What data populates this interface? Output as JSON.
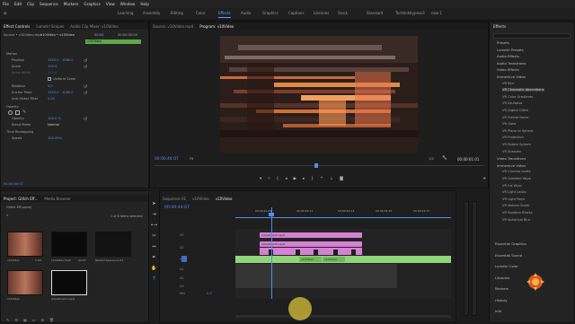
{
  "menu": [
    "File",
    "Edit",
    "Clip",
    "Sequence",
    "Markers",
    "Graphics",
    "View",
    "Window",
    "Help"
  ],
  "workspaces": [
    "Learning",
    "Assembly",
    "Editing",
    "Color",
    "Effects",
    "Audio",
    "Graphics",
    "Captions",
    "Libraries",
    "Stock",
    "Standard",
    "Techlinkbypass3",
    "new 1"
  ],
  "active_workspace": "Effects",
  "effect_controls": {
    "tabs": [
      "Effect Controls",
      "Lumetri Scopes",
      "Audio Clip Mixer: v10Video"
    ],
    "source": "Source • v10Video.mp4",
    "clip": "v10Video • v10Video",
    "time_start": "00:00",
    "time_end": "00:00:30:00",
    "clip_chip": "v10Video",
    "motion": "Motion",
    "position_label": "Position",
    "position_x": "1920.0",
    "position_y": "1080.0",
    "scale_label": "Scale",
    "scale_val": "100.0",
    "scale_w_label": "Scale Width",
    "scale_w_val": "100.0",
    "uniform": "Uniform Scale",
    "rotation_label": "Rotation",
    "rotation_val": "0.0",
    "anchor_label": "Anchor Point",
    "anchor_x": "1920.0",
    "anchor_y": "1080.0",
    "flicker_label": "Anti-flicker Filter",
    "flicker_val": "0.00",
    "opacity_section": "Opacity",
    "opacity_label": "Opacity",
    "opacity_val": "100.0 %",
    "blend_label": "Blend Mode",
    "blend_val": "Normal",
    "time_remap": "Time Remapping",
    "speed_label": "Speed",
    "speed_val": "100.00%",
    "bottom_time": "00:00:44:07"
  },
  "program": {
    "tabs": [
      "Source: v10Video.mp4",
      "Program: v10Video"
    ],
    "time": "00:00:44:07",
    "fit": "Fit",
    "quality": "1/2",
    "duration": "00:00:01:01"
  },
  "project": {
    "tabs": [
      "Project: Glitch Eff...",
      "Media Browser"
    ],
    "file": "Glitch Eff.prproj",
    "count": "1 of 6 items selected",
    "items": [
      {
        "name": "v10Video",
        "meta": "1:03"
      },
      {
        "name": "v10Video.mp4",
        "meta": "44:07"
      },
      {
        "name": "Adjustment Layer",
        "meta": ""
      },
      {
        "name": "Nested Sequence 01",
        "meta": ""
      },
      {
        "name": "v10Video",
        "meta": "1:03"
      },
      {
        "name": "Adjustment Layer",
        "meta": ""
      }
    ]
  },
  "timeline": {
    "tabs": [
      "Sequence 01",
      "v10Video",
      "v10Video"
    ],
    "time": "00:00:44:07",
    "ruler": [
      "00:00:44:09",
      "00:00:44:11",
      "00:00:44:13",
      "00:00:44:15",
      "00:00:44:17"
    ],
    "tracks": [
      "V3",
      "V2",
      "V1",
      "A1",
      "A2",
      "A3",
      "Mix"
    ],
    "mix_val": "0.0",
    "clip_adj1": "Adjustment Layer",
    "clip_adj2": "Adjustment Layer",
    "clip_v1a": "v10Video",
    "clip_v1b": "v10Video"
  },
  "effects": {
    "title": "Effects",
    "tree": [
      {
        "t": "Presets",
        "h": 1
      },
      {
        "t": "Lumetri Presets",
        "h": 1
      },
      {
        "t": "Audio Effects",
        "h": 1
      },
      {
        "t": "Audio Transitions",
        "h": 1
      },
      {
        "t": "Video Effects",
        "h": 1
      },
      {
        "t": "Immersive Video",
        "h": 1
      },
      {
        "t": "VR Blur",
        "h": 0
      },
      {
        "t": "VR Chromatic Aberrations",
        "h": 0
      },
      {
        "t": "VR Color Gradients",
        "h": 0
      },
      {
        "t": "VR De-Noise",
        "h": 0
      },
      {
        "t": "VR Digital Glitch",
        "h": 0
      },
      {
        "t": "VR Fractal Noise",
        "h": 0
      },
      {
        "t": "VR Glow",
        "h": 0
      },
      {
        "t": "VR Plane to Sphere",
        "h": 0
      },
      {
        "t": "VR Projection",
        "h": 0
      },
      {
        "t": "VR Rotate Sphere",
        "h": 0
      },
      {
        "t": "VR Sharpen",
        "h": 0
      },
      {
        "t": "Video Transitions",
        "h": 1
      },
      {
        "t": "Immersive Video",
        "h": 1
      },
      {
        "t": "VR Chroma Leaks",
        "h": 0
      },
      {
        "t": "VR Gradient Wipe",
        "h": 0
      },
      {
        "t": "VR Iris Wipe",
        "h": 0
      },
      {
        "t": "VR Light Leaks",
        "h": 0
      },
      {
        "t": "VR Light Rays",
        "h": 0
      },
      {
        "t": "VR Mobius Zoom",
        "h": 0
      },
      {
        "t": "VR Random Blocks",
        "h": 0
      },
      {
        "t": "VR Spherical Blur",
        "h": 0
      }
    ],
    "lower": [
      "Essential Graphics",
      "Essential Sound",
      "Lumetri Color",
      "Libraries",
      "Markers",
      "History",
      "Info"
    ]
  },
  "colors": {
    "accent": "#5ba3ff",
    "adjustment": "#d580d5",
    "video": "#8fd67a"
  }
}
